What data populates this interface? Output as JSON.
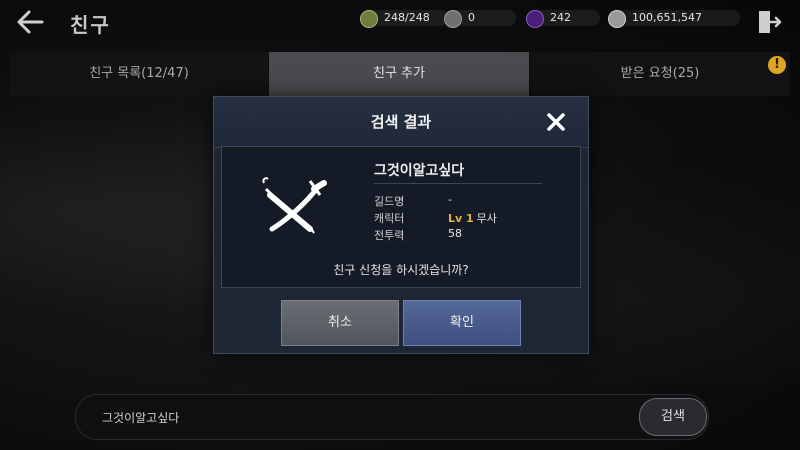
{
  "header": {
    "title": "친구",
    "resources": [
      {
        "icon": "energy-icon",
        "value": "248/248",
        "color": "#7b8b4a"
      },
      {
        "icon": "silver-orb-icon",
        "value": "0",
        "color": "#8a8a8a"
      },
      {
        "icon": "purple-gem-icon",
        "value": "242",
        "color": "#6a3aa0"
      },
      {
        "icon": "coin-icon",
        "value": "100,651,547",
        "color": "#b7b7b7"
      }
    ]
  },
  "tabs": [
    {
      "label": "친구 목록(12/47)",
      "active": false
    },
    {
      "label": "친구 추가",
      "active": true
    },
    {
      "label": "받은 요청(25)",
      "active": false
    }
  ],
  "alert_badge": "!",
  "search": {
    "value": "그것이알고싶다",
    "button_label": "검색"
  },
  "modal": {
    "title": "검색 결과",
    "character": {
      "name": "그것이알고싶다",
      "guild_label": "길드명",
      "guild_value": "-",
      "character_label": "캐릭터",
      "level": "Lv 1",
      "class": "무사",
      "power_label": "전투력",
      "power_value": "58"
    },
    "question": "친구 신청을 하시겠습니까?",
    "cancel_label": "취소",
    "confirm_label": "확인"
  },
  "colors": {
    "accent_gold": "#e1b046",
    "confirm_blue": "#4a5d8c",
    "alert_yellow": "#e0a526"
  }
}
